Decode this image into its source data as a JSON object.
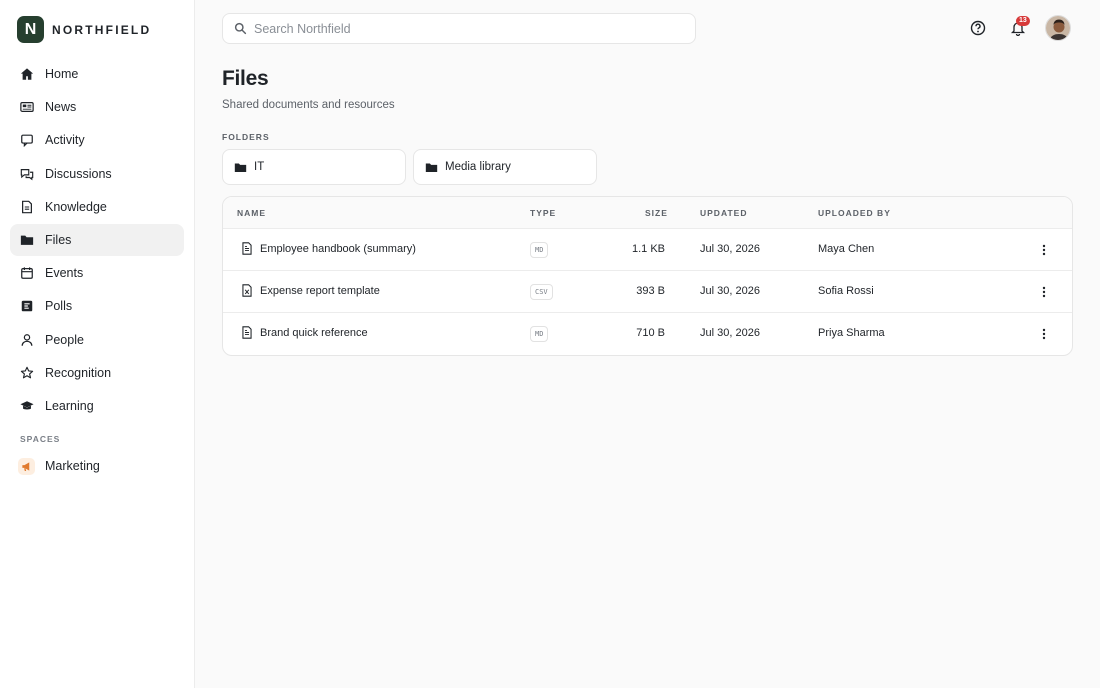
{
  "brand": {
    "logo_letter": "N",
    "name": "NORTHFIELD"
  },
  "nav": {
    "items": [
      {
        "label": "Home",
        "icon": "home-icon"
      },
      {
        "label": "News",
        "icon": "newspaper-icon"
      },
      {
        "label": "Activity",
        "icon": "activity-icon"
      },
      {
        "label": "Discussions",
        "icon": "discussions-icon"
      },
      {
        "label": "Knowledge",
        "icon": "knowledge-icon"
      },
      {
        "label": "Files",
        "icon": "folder-icon",
        "active": true
      },
      {
        "label": "Events",
        "icon": "calendar-icon"
      },
      {
        "label": "Polls",
        "icon": "polls-icon"
      },
      {
        "label": "People",
        "icon": "person-icon"
      },
      {
        "label": "Recognition",
        "icon": "star-icon"
      },
      {
        "label": "Learning",
        "icon": "graduation-cap-icon"
      }
    ],
    "spaces_label": "SPACES",
    "spaces": [
      {
        "label": "Marketing",
        "icon": "megaphone-icon"
      }
    ]
  },
  "search": {
    "placeholder": "Search Northfield"
  },
  "header": {
    "notification_count": "13"
  },
  "page": {
    "title": "Files",
    "subtitle": "Shared documents and resources",
    "folders_label": "FOLDERS",
    "folders": [
      {
        "label": "IT"
      },
      {
        "label": "Media library"
      }
    ]
  },
  "table": {
    "columns": {
      "name": "NAME",
      "type": "TYPE",
      "size": "SIZE",
      "updated": "UPDATED",
      "uploaded_by": "UPLOADED BY"
    },
    "rows": [
      {
        "name": "Employee handbook (summary)",
        "type": "MD",
        "size": "1.1 KB",
        "updated": "Jul 30, 2026",
        "uploaded_by": "Maya Chen"
      },
      {
        "name": "Expense report template",
        "type": "CSV",
        "size": "393 B",
        "updated": "Jul 30, 2026",
        "uploaded_by": "Sofia Rossi"
      },
      {
        "name": "Brand quick reference",
        "type": "MD",
        "size": "710 B",
        "updated": "Jul 30, 2026",
        "uploaded_by": "Priya Sharma"
      }
    ]
  },
  "colors": {
    "brand": "#263f2f",
    "badge": "#d73a3a",
    "marketing_icon": "#e07a2e"
  }
}
